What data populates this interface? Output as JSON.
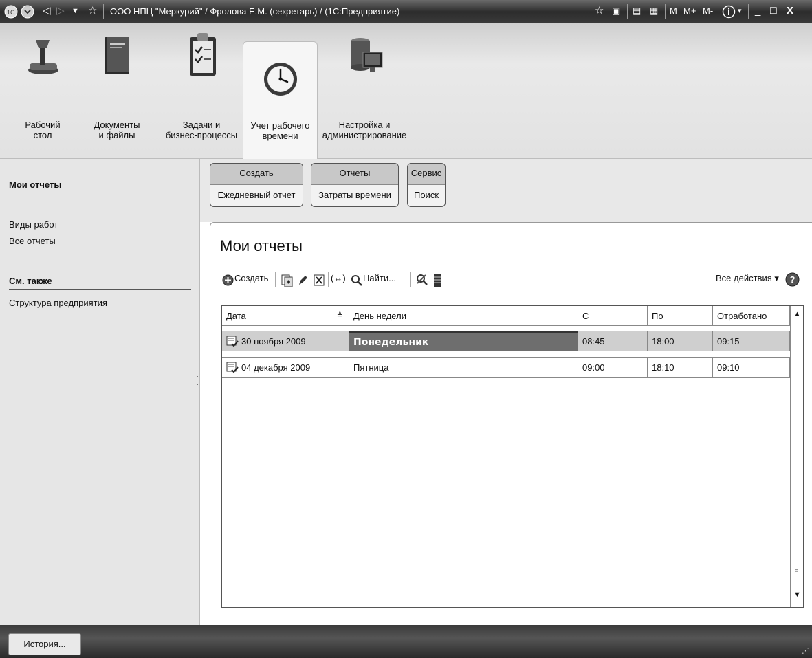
{
  "window": {
    "title": "ООО НПЦ \"Меркурий\" / Фролова Е.М. (секретарь) / (1С:Предприятие)",
    "calc_labels": [
      "M",
      "M+",
      "M-"
    ]
  },
  "sections": [
    {
      "label": "Рабочий\nстол",
      "icon": "desk-lamp-icon"
    },
    {
      "label": "Документы\nи файлы",
      "icon": "book-icon"
    },
    {
      "label": "Задачи и\nбизнес-процессы",
      "icon": "clipboard-icon"
    },
    {
      "label": "Учет рабочего\nвремени",
      "icon": "clock-icon",
      "active": true
    },
    {
      "label": "Настройка и\nадминистрирование",
      "icon": "server-icon"
    }
  ],
  "nav": {
    "title": "Мои отчеты",
    "items": [
      "Виды работ",
      "Все отчеты"
    ],
    "see_also_header": "См. также",
    "see_also_items": [
      "Структура предприятия"
    ]
  },
  "commands": [
    {
      "header": "Создать",
      "item": "Ежедневный отчет"
    },
    {
      "header": "Отчеты",
      "item": "Затраты времени"
    },
    {
      "header": "Сервис",
      "item": "Поиск"
    }
  ],
  "form": {
    "title": "Мои отчеты",
    "create_label": "Создать",
    "find_label": "Найти...",
    "all_actions_label": "Все действия ▾"
  },
  "table": {
    "columns": [
      "Дата",
      "День недели",
      "С",
      "По",
      "Отработано"
    ],
    "rows": [
      [
        "30 ноября 2009",
        "Понедельник",
        "08:45",
        "18:00",
        "09:15"
      ],
      [
        "04 декабря 2009",
        "Пятница",
        "09:00",
        "18:10",
        "09:10"
      ]
    ]
  },
  "footer": {
    "history_label": "История..."
  }
}
